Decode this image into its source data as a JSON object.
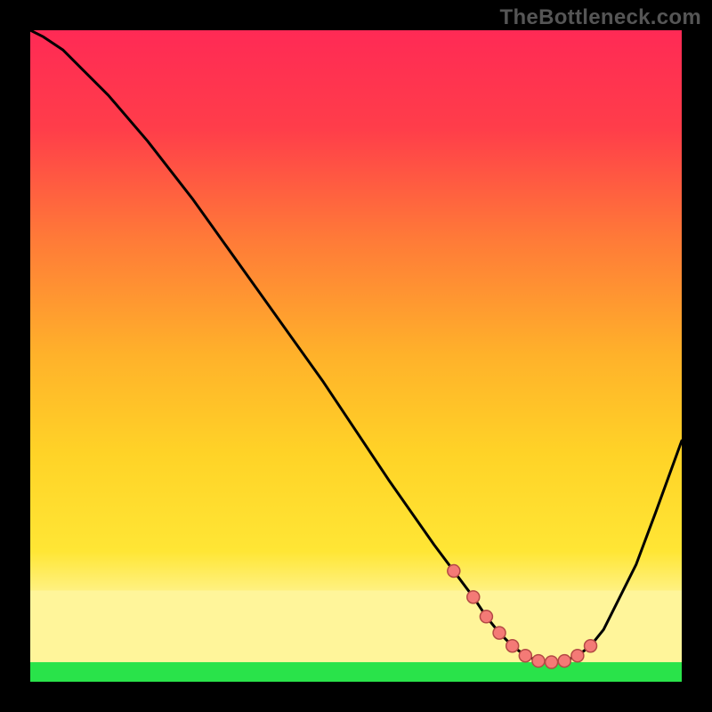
{
  "watermark": "TheBottleneck.com",
  "colors": {
    "bg": "#000000",
    "curve": "#000000",
    "marker_fill": "#f47a76",
    "marker_stroke": "#b44a45",
    "band_green": "#29e34a",
    "band_yellow_top": "#fff59a",
    "band_yellow": "#ffe24a",
    "grad_top": "#ff2a55",
    "grad_mid_upper": "#ff6a3a",
    "grad_mid": "#ffc225",
    "grad_low": "#f7ea2b"
  },
  "chart_data": {
    "type": "line",
    "title": "",
    "xlabel": "",
    "ylabel": "",
    "xlim": [
      0,
      100
    ],
    "ylim": [
      0,
      100
    ],
    "grid": false,
    "legend": false,
    "series": [
      {
        "name": "curve",
        "x": [
          0,
          2,
          5,
          8,
          12,
          18,
          25,
          35,
          45,
          55,
          62,
          65,
          68,
          70,
          72,
          74,
          76,
          78,
          80,
          82,
          84,
          86,
          88,
          90,
          93,
          96,
          100
        ],
        "y": [
          100,
          99,
          97,
          94,
          90,
          83,
          74,
          60,
          46,
          31,
          21,
          17,
          13,
          10,
          7.5,
          5.5,
          4,
          3.2,
          3,
          3.2,
          4,
          5.5,
          8,
          12,
          18,
          26,
          37
        ]
      }
    ],
    "markers": [
      {
        "x": 65,
        "y": 17.0
      },
      {
        "x": 68,
        "y": 13.0
      },
      {
        "x": 70,
        "y": 10.0
      },
      {
        "x": 72,
        "y": 7.5
      },
      {
        "x": 74,
        "y": 5.5
      },
      {
        "x": 76,
        "y": 4.0
      },
      {
        "x": 78,
        "y": 3.2
      },
      {
        "x": 80,
        "y": 3.0
      },
      {
        "x": 82,
        "y": 3.2
      },
      {
        "x": 84,
        "y": 4.0
      },
      {
        "x": 86,
        "y": 5.5
      }
    ],
    "bands": [
      {
        "name": "green",
        "ymin": 0,
        "ymax": 3
      },
      {
        "name": "light-yellow",
        "ymin": 3,
        "ymax": 14
      }
    ]
  }
}
